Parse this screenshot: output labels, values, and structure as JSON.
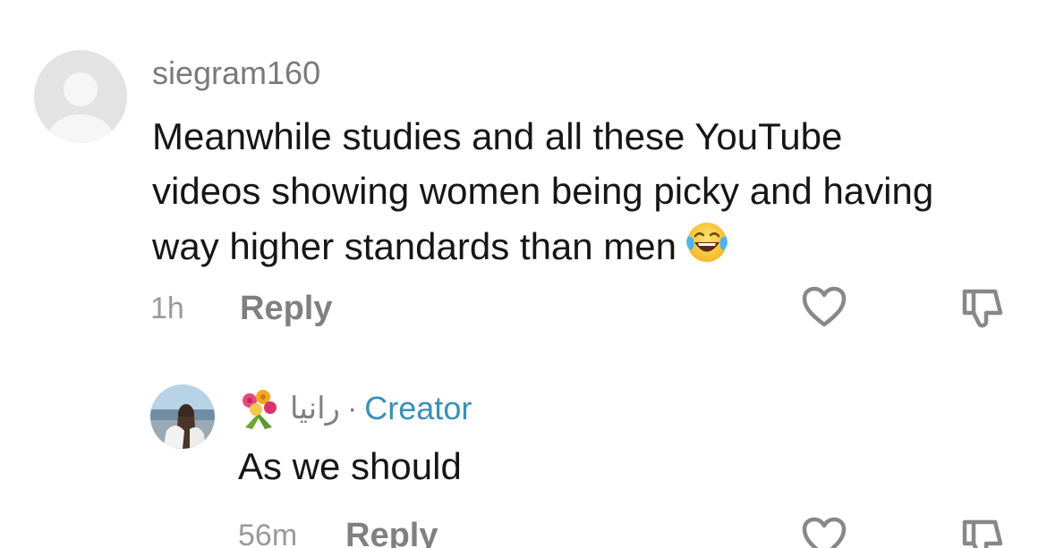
{
  "comment": {
    "username": "siegram160",
    "text": "Meanwhile studies and all these YouTube videos showing women being picky and having way higher standards than men",
    "emoji": "laughing-tears-emoji",
    "time": "1h",
    "reply_label": "Reply"
  },
  "reply": {
    "name_emoji": "bouquet-emoji",
    "name": "رانيا",
    "separator": "·",
    "badge": "Creator",
    "text": "As we should",
    "time": "56m",
    "reply_label": "Reply"
  },
  "colors": {
    "creator_badge": "#3a8fb8",
    "secondary_text": "#808080",
    "primary_text": "#161616"
  }
}
